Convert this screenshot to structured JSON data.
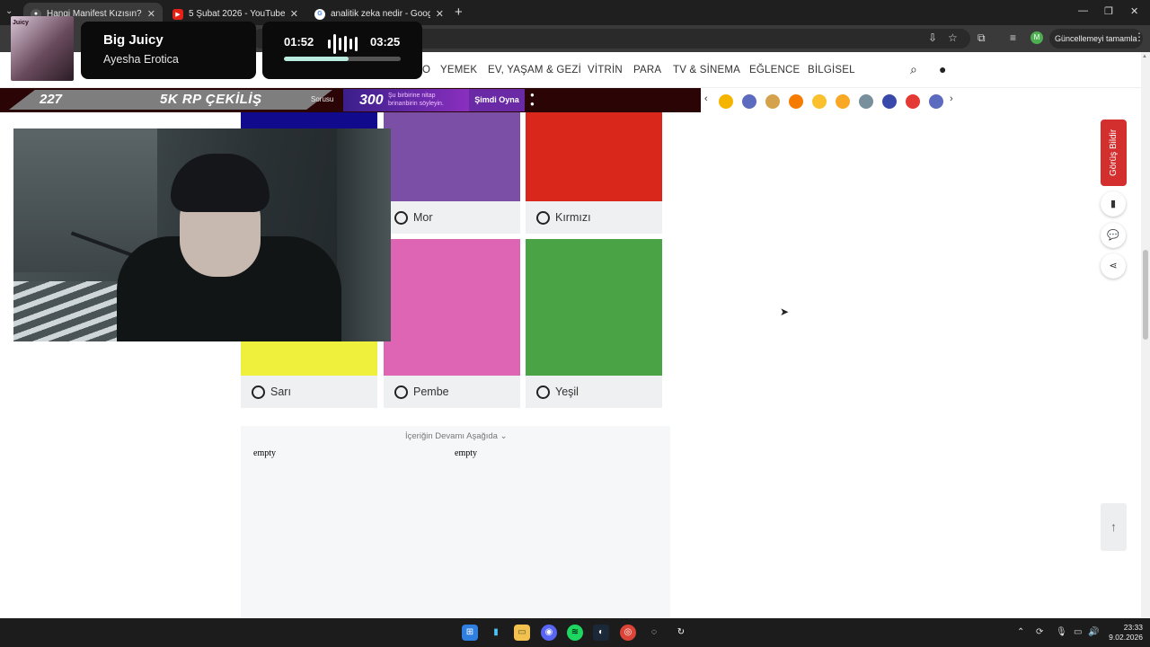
{
  "browser": {
    "tabs": [
      {
        "title": "Hangi Manifest Kızısın? - Oned",
        "active": true
      },
      {
        "title": "5 Şubat 2026 - YouTube",
        "active": false
      },
      {
        "title": "analitik zeka nedir - Google'da",
        "active": false
      }
    ],
    "profile_initial": "M",
    "update_button": "Güncellemeyi tamamla"
  },
  "site_nav": {
    "partial_item": "O",
    "items": [
      "YEMEK",
      "EV, YAŞAM & GEZİ",
      "VİTRİN",
      "PARA",
      "TV & SİNEMA",
      "EĞLENCE",
      "BİLGİSEL"
    ]
  },
  "ad": {
    "num1": "227",
    "headline": "5K RP ÇEKİLİŞ",
    "sorusu": "Sorusu",
    "num2": "300",
    "small_line1": "Şu birbirine nitap",
    "small_line2": "brinanbirin söyleyin.",
    "cta": "Şimdi Oyna"
  },
  "reactions": {
    "colors": [
      "#f4b400",
      "#5c6bc0",
      "#d4a24c",
      "#f57c00",
      "#fbc02d",
      "#f9a825",
      "#78909c",
      "#3949ab",
      "#e53935",
      "#5c6bc0"
    ]
  },
  "quiz": {
    "options": [
      {
        "label": "Mor",
        "color": "#7b4fa6"
      },
      {
        "label": "Kırmızı",
        "color": "#d9271b"
      },
      {
        "label": "Sarı",
        "color": "#eef03c"
      },
      {
        "label": "Pembe",
        "color": "#de65b4"
      },
      {
        "label": "Yeşil",
        "color": "#4aa446"
      }
    ],
    "top_left_color": "#120a8c"
  },
  "content": {
    "heading": "İçeriğin Devamı Aşağıda",
    "empty_left": "empty",
    "empty_right": "empty"
  },
  "rail": {
    "feedback": "Görüş Bildir"
  },
  "overlay": {
    "album_text": "Juicy",
    "song": "Big Juicy",
    "artist": "Ayesha Erotica",
    "time_current": "01:52",
    "time_total": "03:25",
    "progress": 0.55
  },
  "tray": {
    "time": "23:33",
    "date": "9.02.2026"
  }
}
